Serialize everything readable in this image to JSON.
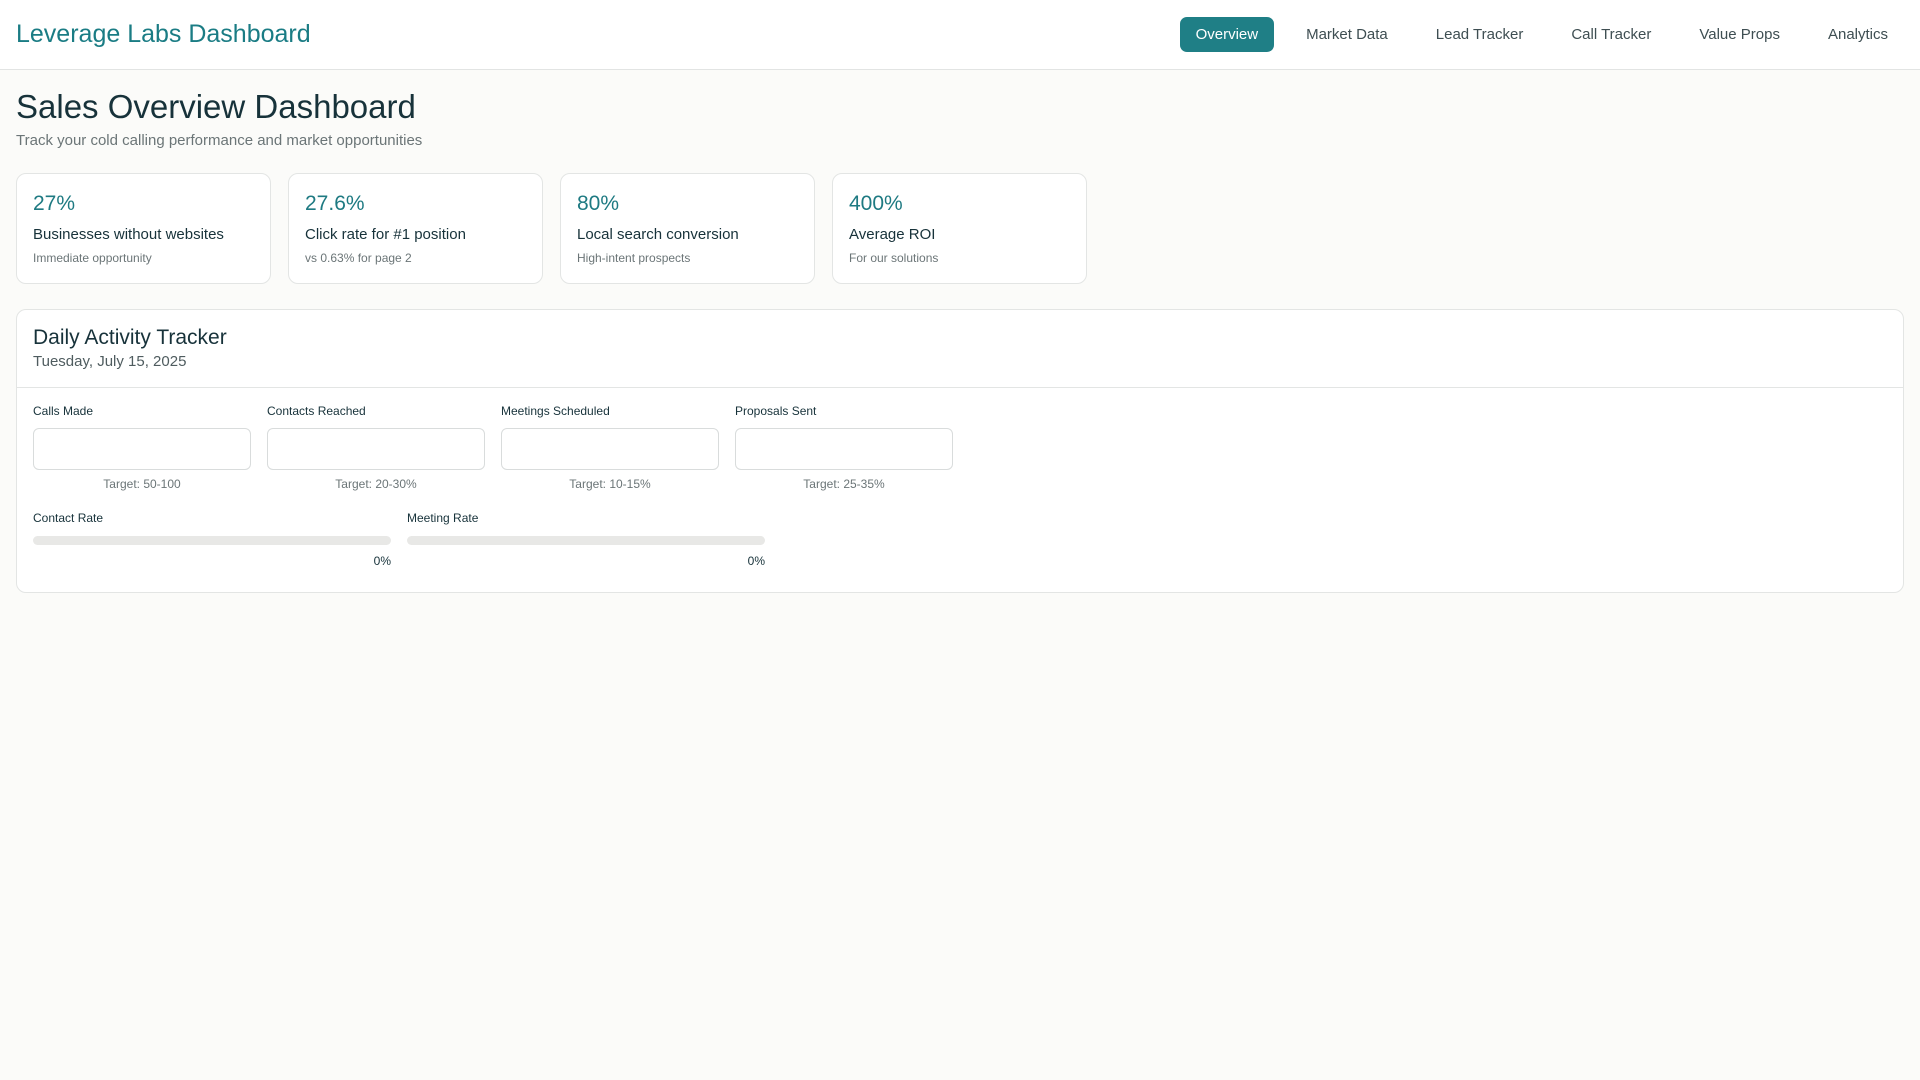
{
  "header": {
    "brand": "Leverage Labs Dashboard",
    "nav": [
      "Overview",
      "Market Data",
      "Lead Tracker",
      "Call Tracker",
      "Value Props",
      "Analytics"
    ],
    "active_nav": "Overview"
  },
  "page": {
    "title": "Sales Overview Dashboard",
    "subtitle": "Track your cold calling performance and market opportunities"
  },
  "stats": [
    {
      "value": "27%",
      "label": "Businesses without websites",
      "note": "Immediate opportunity"
    },
    {
      "value": "27.6%",
      "label": "Click rate for #1 position",
      "note": "vs 0.63% for page 2"
    },
    {
      "value": "80%",
      "label": "Local search conversion",
      "note": "High-intent prospects"
    },
    {
      "value": "400%",
      "label": "Average ROI",
      "note": "For our solutions"
    }
  ],
  "tracker": {
    "title": "Daily Activity Tracker",
    "date": "Tuesday, July 15, 2025",
    "fields": [
      {
        "label": "Calls Made",
        "value": "",
        "target": "Target: 50-100"
      },
      {
        "label": "Contacts Reached",
        "value": "",
        "target": "Target: 20-30%"
      },
      {
        "label": "Meetings Scheduled",
        "value": "",
        "target": "Target: 10-15%"
      },
      {
        "label": "Proposals Sent",
        "value": "",
        "target": "Target: 25-35%"
      }
    ],
    "rates": [
      {
        "label": "Contact Rate",
        "percent": 0,
        "display": "0%"
      },
      {
        "label": "Meeting Rate",
        "percent": 0,
        "display": "0%"
      }
    ]
  },
  "colors": {
    "accent": "#1f7f86",
    "brand": "#1a7c84",
    "background": "#fbfbf9"
  }
}
